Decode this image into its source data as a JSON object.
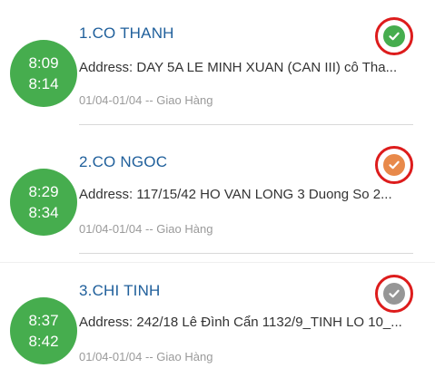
{
  "deliveries": [
    {
      "title": "1.CO THANH",
      "time_start": "8:09",
      "time_end": "8:14",
      "address": "Address: DAY 5A LE MINH XUAN (CAN III)  cô Tha...",
      "meta": "01/04-01/04 -- Giao Hàng",
      "status_color": "#46ad4e"
    },
    {
      "title": "2.CO NGOC",
      "time_start": "8:29",
      "time_end": "8:34",
      "address": "Address: 117/15/42 HO VAN LONG 3 Duong So 2...",
      "meta": "01/04-01/04 -- Giao Hàng",
      "status_color": "#e8894a"
    },
    {
      "title": "3.CHI TINH",
      "time_start": "8:37",
      "time_end": "8:42",
      "address": "Address: 242/18 Lê Đình Cẩn 1132/9_TINH LO 10_...",
      "meta": "01/04-01/04 -- Giao Hàng",
      "status_color": "#969696"
    }
  ],
  "colors": {
    "time_badge": "#46ad4e",
    "title": "#1f5f9b",
    "status_ring": "#dd1c1c"
  }
}
